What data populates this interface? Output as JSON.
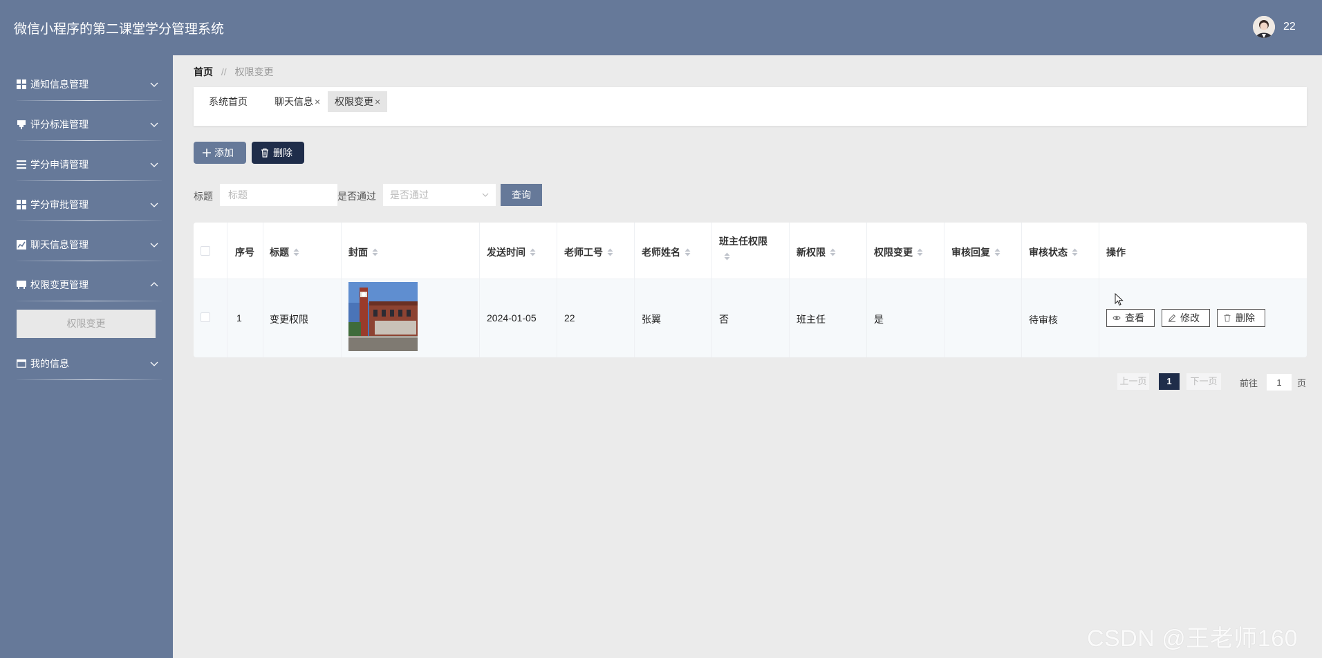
{
  "header": {
    "title": "微信小程序的第二课堂学分管理系统",
    "username": "22"
  },
  "sidebar": {
    "items": [
      {
        "label": "通知信息管理",
        "icon": "grid-icon"
      },
      {
        "label": "评分标准管理",
        "icon": "pin-icon"
      },
      {
        "label": "学分申请管理",
        "icon": "list-icon"
      },
      {
        "label": "学分审批管理",
        "icon": "grid-icon"
      },
      {
        "label": "聊天信息管理",
        "icon": "chart-icon"
      },
      {
        "label": "权限变更管理",
        "icon": "box-icon",
        "expanded": true
      },
      {
        "label": "我的信息",
        "icon": "card-icon"
      }
    ],
    "submenu": {
      "label": "权限变更"
    }
  },
  "breadcrumb": {
    "home": "首页",
    "separator": "//",
    "current": "权限变更"
  },
  "tags": [
    {
      "label": "系统首页",
      "closable": false
    },
    {
      "label": "聊天信息",
      "closable": true
    },
    {
      "label": "权限变更",
      "closable": true,
      "active": true
    }
  ],
  "tag_close": "×",
  "actions": {
    "add": "添加",
    "delete": "删除"
  },
  "search": {
    "title_label": "标题",
    "title_placeholder": "标题",
    "pass_label": "是否通过",
    "pass_placeholder": "是否通过",
    "query": "查询"
  },
  "table": {
    "columns": [
      "序号",
      "标题",
      "封面",
      "发送时间",
      "老师工号",
      "老师姓名",
      "班主任权限",
      "新权限",
      "权限变更",
      "审核回复",
      "审核状态",
      "操作"
    ],
    "rows": [
      {
        "index": "1",
        "title": "变更权限",
        "cover": "building-photo",
        "send_time": "2024-01-05",
        "teacher_id": "22",
        "teacher_name": "张翼",
        "head_teacher": "否",
        "new_permission": "班主任",
        "changed": "是",
        "reply": "",
        "status": "待审核"
      }
    ],
    "ops": {
      "view": "查看",
      "edit": "修改",
      "delete": "删除"
    }
  },
  "pagination": {
    "prev": "上一页",
    "current": "1",
    "next": "下一页",
    "goto": "前往",
    "page_input": "1",
    "page_unit": "页"
  },
  "watermark": "CSDN @王老师160",
  "colors": {
    "header": "#667999",
    "sidebar": "#667999",
    "dark": "#1f2d4a",
    "background": "#ebebeb"
  }
}
